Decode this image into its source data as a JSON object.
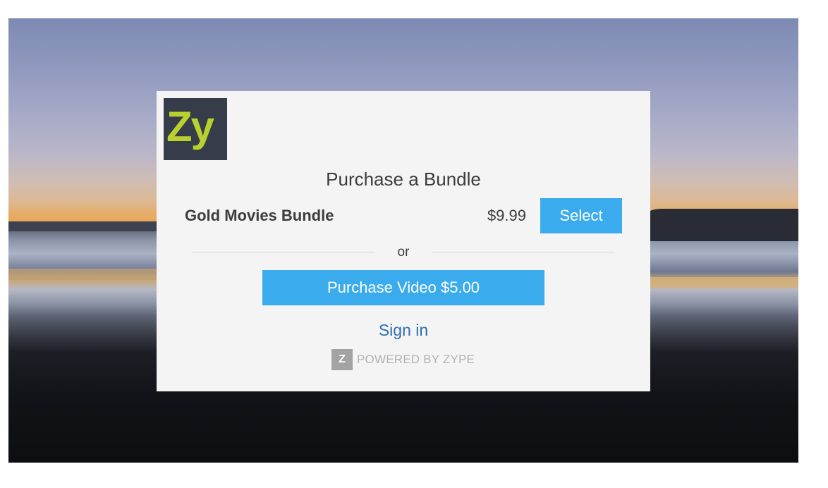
{
  "logo": {
    "text": "Zy"
  },
  "dialog": {
    "title": "Purchase a Bundle",
    "bundle": {
      "name": "Gold Movies Bundle",
      "price": "$9.99",
      "select_label": "Select"
    },
    "or_label": "or",
    "purchase_video_label": "Purchase Video $5.00",
    "signin_label": "Sign in",
    "powered_by": {
      "badge": "Z",
      "text": "POWERED BY ZYPE"
    }
  },
  "colors": {
    "accent": "#3aabed",
    "link": "#2f6fb3",
    "logo_bg": "#373c4a",
    "logo_fg": "#b8d12f"
  }
}
